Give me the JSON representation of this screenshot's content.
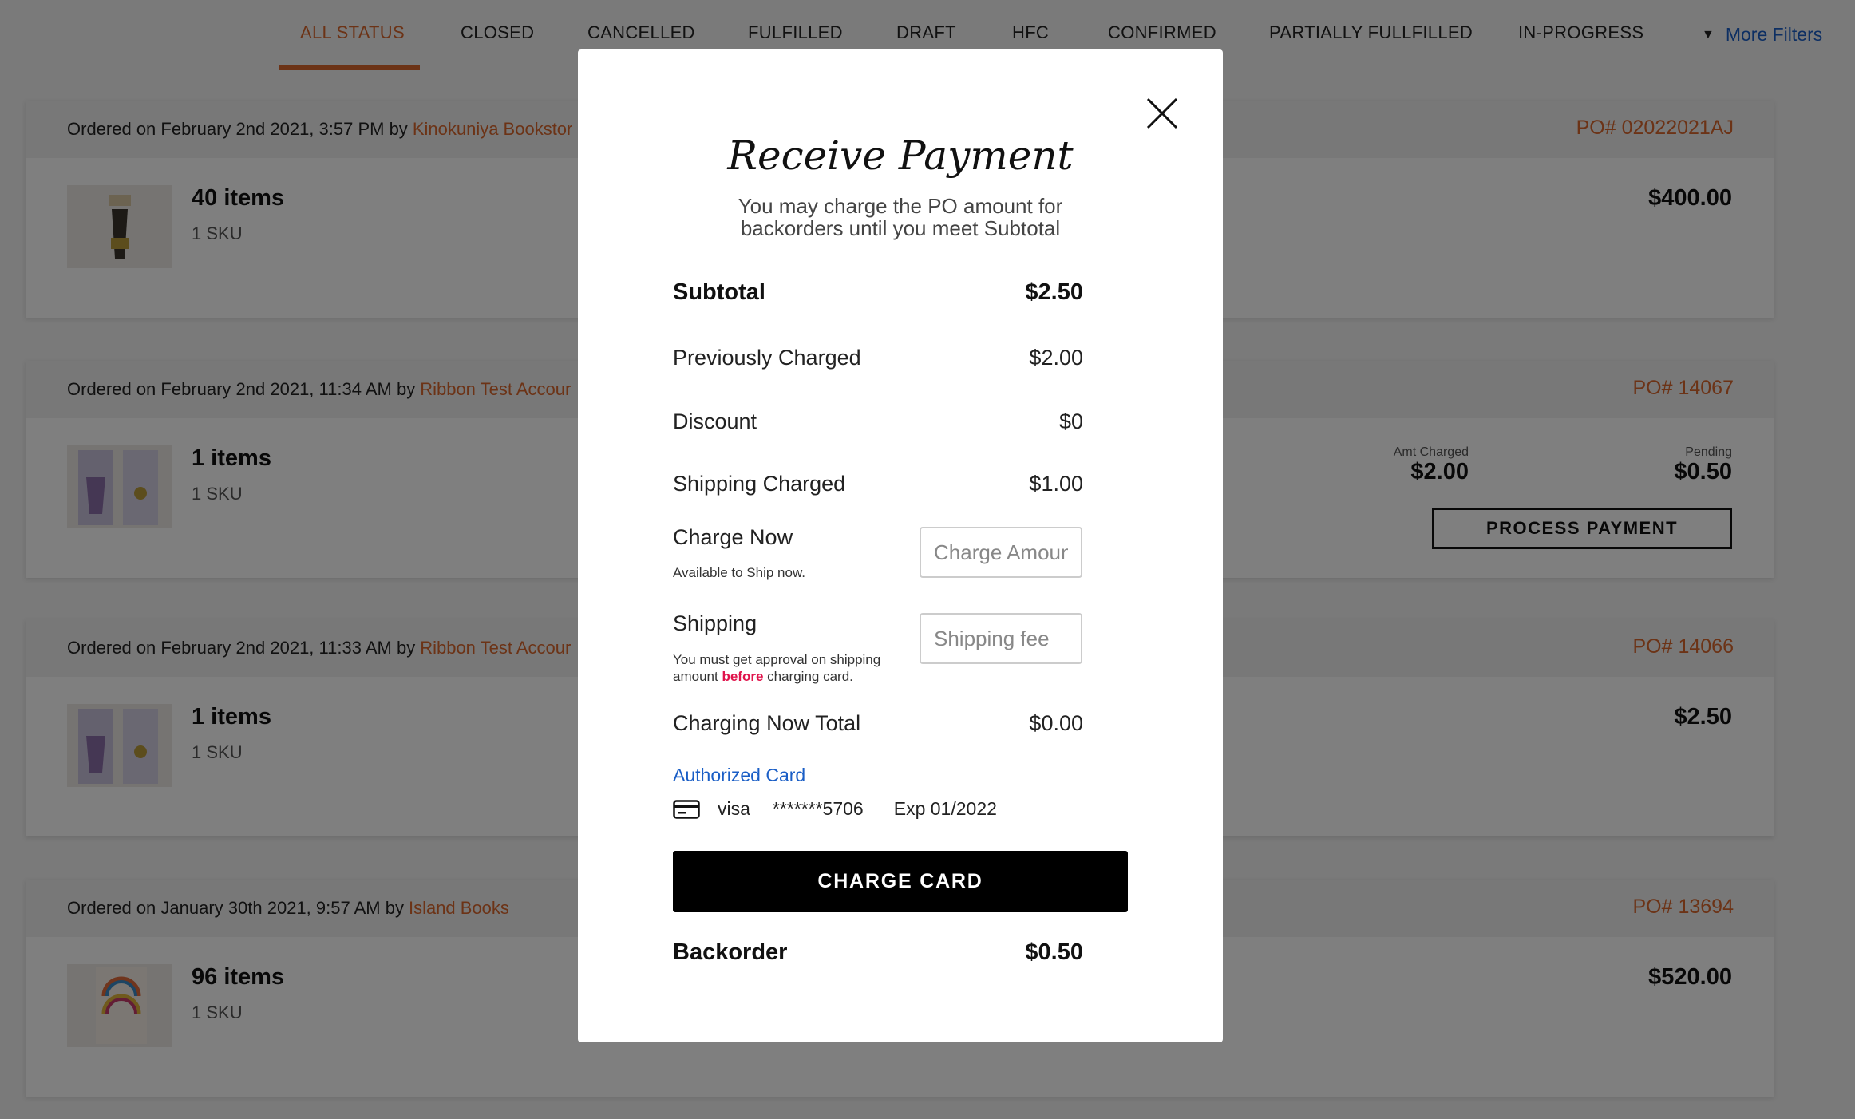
{
  "tabs": [
    {
      "label": "ALL STATUS"
    },
    {
      "label": "CLOSED"
    },
    {
      "label": "CANCELLED"
    },
    {
      "label": "FULFILLED"
    },
    {
      "label": "DRAFT"
    },
    {
      "label": "HFC"
    },
    {
      "label": "CONFIRMED"
    },
    {
      "label": "PARTIALLY FULLFILLED"
    },
    {
      "label": "IN-PROGRESS"
    }
  ],
  "filters": {
    "icon": "filter-icon",
    "label": "More Filters"
  },
  "orders": [
    {
      "ordered_prefix": "Ordered on February 2nd 2021, 3:57 PM by",
      "by_name": "Kinokuniya Bookstor",
      "po": "PO# 02022021AJ",
      "items": "40 items",
      "sku": "1 SKU",
      "total": "$400.00"
    },
    {
      "ordered_prefix": "Ordered on February 2nd 2021, 11:34 AM by",
      "by_name": "Ribbon Test Accour",
      "po": "PO# 14067",
      "items": "1 items",
      "sku": "1 SKU",
      "amt_charged_label": "Amt Charged",
      "amt_charged": "$2.00",
      "pending_label": "Pending",
      "pending": "$0.50",
      "process_label": "PROCESS PAYMENT"
    },
    {
      "ordered_prefix": "Ordered on February 2nd 2021, 11:33 AM by",
      "by_name": "Ribbon Test Accour",
      "po": "PO# 14066",
      "items": "1 items",
      "sku": "1 SKU",
      "total": "$2.50"
    },
    {
      "ordered_prefix": "Ordered on January 30th 2021, 9:57 AM by",
      "by_name": "Island Books",
      "po": "PO# 13694",
      "items": "96 items",
      "sku": "1 SKU",
      "total": "$520.00"
    }
  ],
  "modal": {
    "title": "Receive Payment",
    "subtitle": "You may charge the PO amount for backorders until you meet Subtotal",
    "subtotal": {
      "label": "Subtotal",
      "value": "$2.50"
    },
    "previously_charged": {
      "label": "Previously Charged",
      "value": "$2.00"
    },
    "discount": {
      "label": "Discount",
      "value": "$0"
    },
    "shipping_charged": {
      "label": "Shipping Charged",
      "value": "$1.00"
    },
    "charge_now": {
      "label": "Charge Now",
      "hint": "Available to Ship now.",
      "placeholder": "Charge Amount",
      "value": ""
    },
    "shipping": {
      "label": "Shipping",
      "hint_pre": "You must get approval on shipping amount",
      "hint_warn": "before",
      "hint_post": "charging card.",
      "placeholder": "Shipping fee",
      "value": ""
    },
    "charging_total": {
      "label": "Charging Now Total",
      "value": "$0.00"
    },
    "authorized_card": {
      "label": "Authorized Card",
      "brand": "visa",
      "number": "*******5706",
      "exp": "Exp 01/2022"
    },
    "charge_button": "CHARGE CARD",
    "backorder": {
      "label": "Backorder",
      "value": "$0.50"
    }
  },
  "colors": {
    "accent": "#d9662d",
    "link": "#1a5ec6",
    "warning": "#e0144c",
    "overlay": "rgba(0,0,0,0.5)"
  }
}
